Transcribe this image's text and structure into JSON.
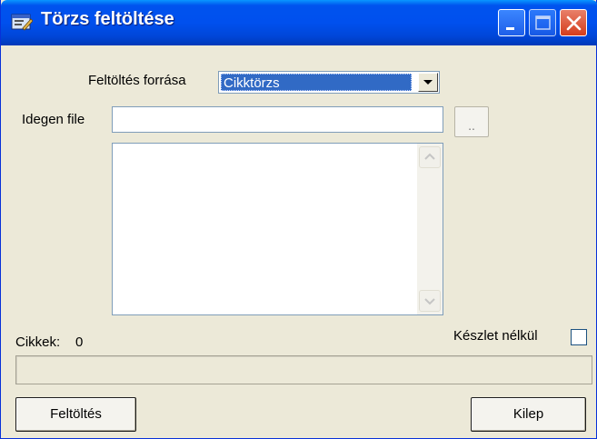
{
  "window": {
    "title": "Törzs feltöltése",
    "title_bar_color": "#0053ee",
    "face_color": "#ece9d8"
  },
  "form": {
    "source_label": "Feltöltés forrása",
    "source_selected": "Cikktörzs",
    "foreign_file_label": "Idegen file",
    "foreign_file_value": "",
    "browse_label": "..",
    "items_label": "Cikkek:",
    "items_count": "0",
    "without_stock_label": "Készlet nélkül",
    "without_stock_checked": false,
    "progress_fraction": 0
  },
  "buttons": {
    "upload_label": "Feltöltés",
    "exit_label": "Kilep"
  }
}
